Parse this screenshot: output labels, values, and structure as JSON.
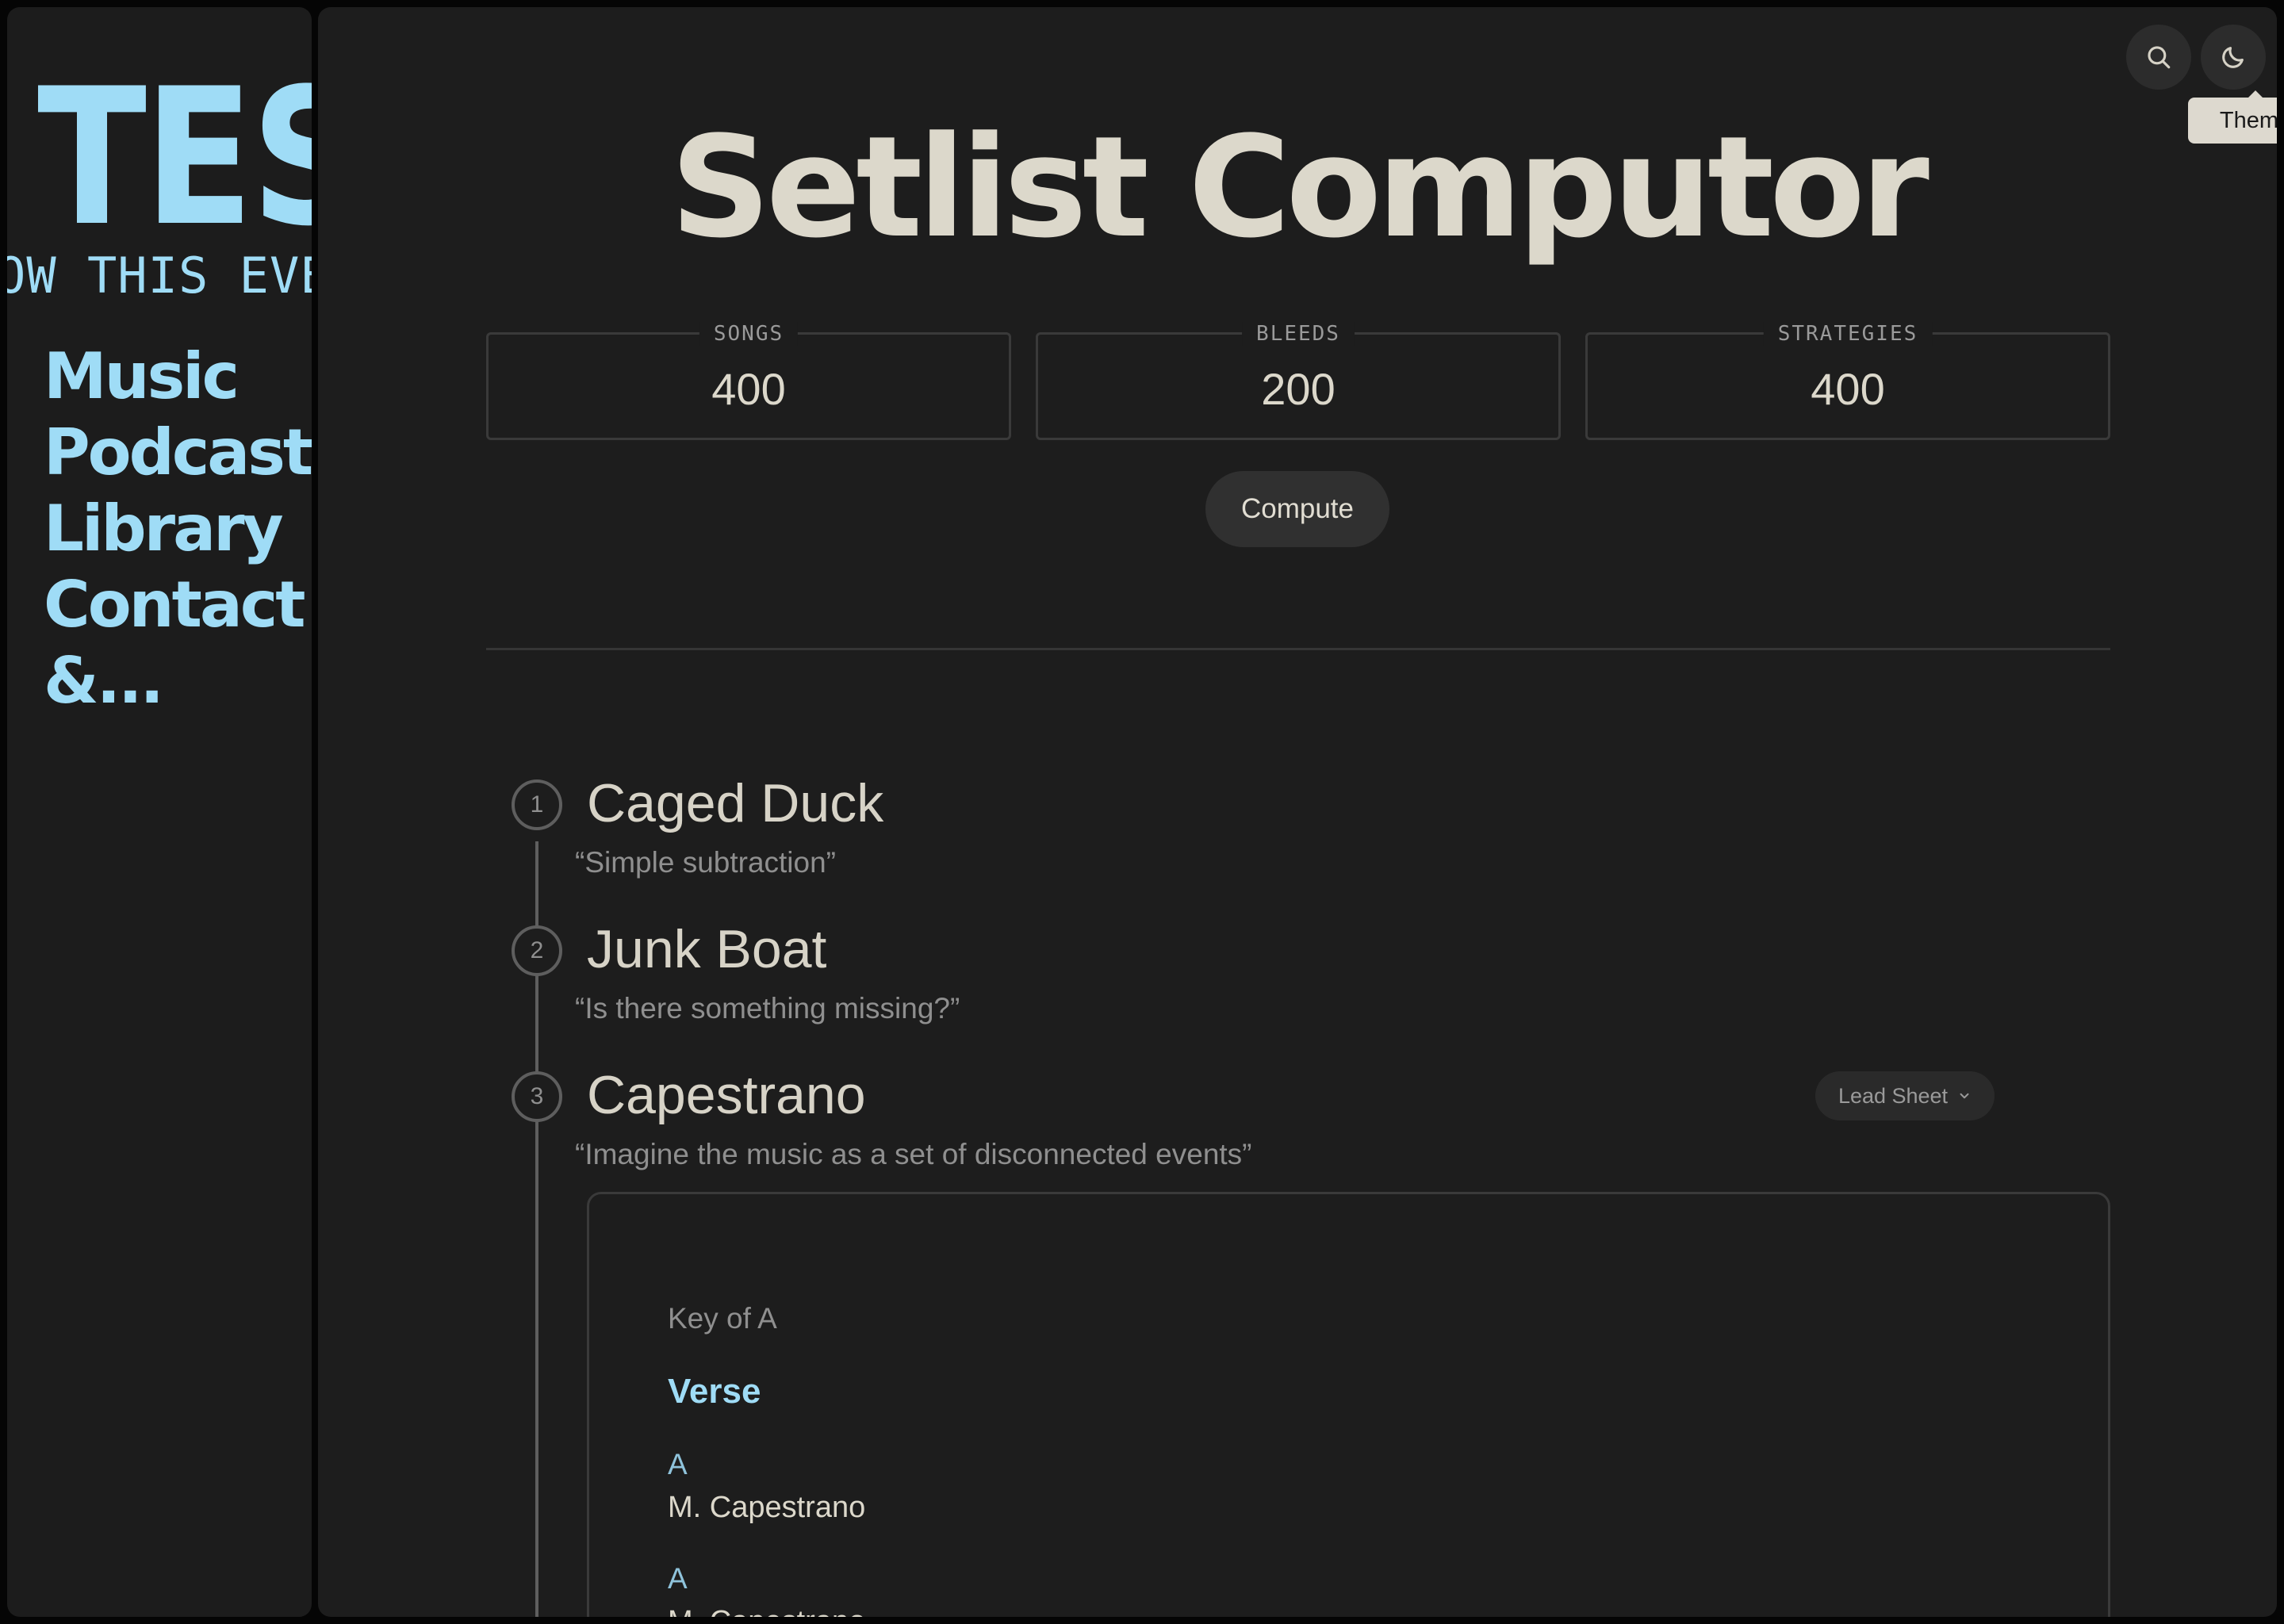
{
  "sidebar": {
    "logo_mark": "TES",
    "logo_tagline": "OW THIS EVEN",
    "nav": [
      "Music",
      "Podcast",
      "Library",
      "Contact",
      "&..."
    ]
  },
  "header": {
    "search_icon": "search-icon",
    "theme_icon": "moon-icon",
    "theme_tooltip": "Theme"
  },
  "page": {
    "title": "Setlist Computor"
  },
  "fields": {
    "songs": {
      "label": "SONGS",
      "value": "400"
    },
    "bleeds": {
      "label": "BLEEDS",
      "value": "200"
    },
    "strategies": {
      "label": "STRATEGIES",
      "value": "400"
    }
  },
  "compute_label": "Compute",
  "setlist": [
    {
      "number": "1",
      "title": "Caged Duck",
      "strategy": "“Simple subtraction”"
    },
    {
      "number": "2",
      "title": "Junk Boat",
      "strategy": "“Is there something missing?”"
    },
    {
      "number": "3",
      "title": "Capestrano",
      "strategy": "“Imagine the music as a set of disconnected events”"
    }
  ],
  "view_select": {
    "value": "Lead Sheet"
  },
  "lead_sheet": {
    "key": "Key of A",
    "section": "Verse",
    "lines": [
      {
        "chord": "A",
        "lyric": "M. Capestrano"
      },
      {
        "chord": "A",
        "lyric": "M. Capestrano"
      }
    ]
  },
  "colors": {
    "accent": "#9fdcf6",
    "title": "#dcd8cb",
    "panel": "#1d1d1d",
    "sidebar": "#1c1c1c"
  }
}
